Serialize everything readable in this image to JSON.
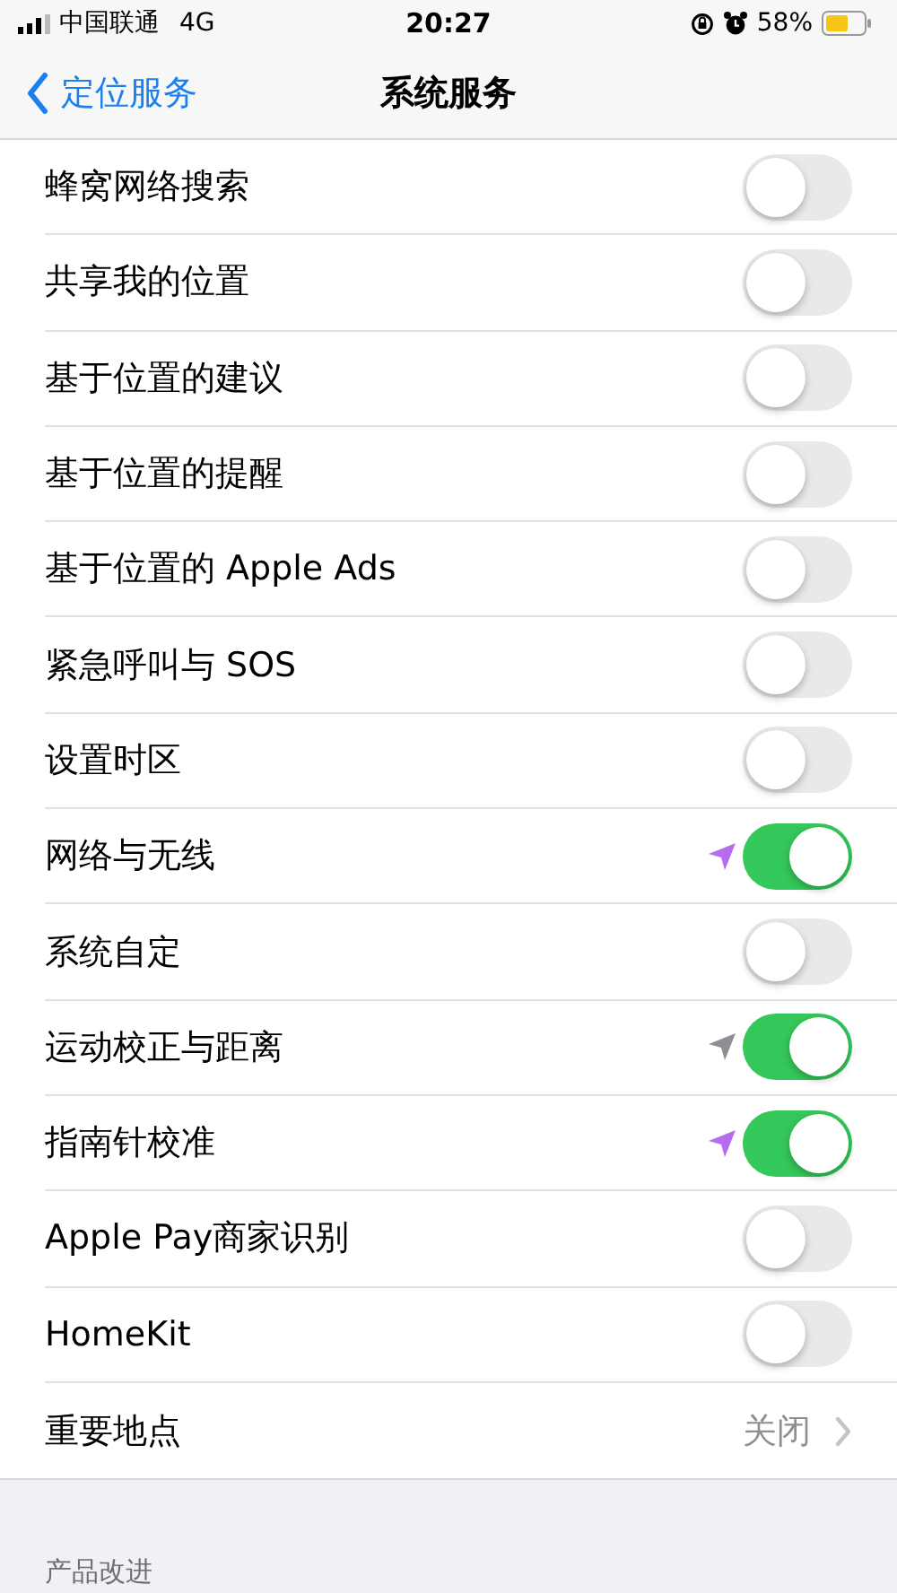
{
  "status_bar": {
    "carrier": "中国联通",
    "network": "4G",
    "time": "20:27",
    "battery": "58%"
  },
  "nav_bar": {
    "back": "定位服务",
    "title": "系统服务"
  },
  "rows": [
    {
      "kind": "toggle",
      "label": "蜂窝网络搜索",
      "on": false
    },
    {
      "kind": "toggle",
      "label": "共享我的位置",
      "on": false
    },
    {
      "kind": "toggle",
      "label": "基于位置的建议",
      "on": false
    },
    {
      "kind": "toggle",
      "label": "基于位置的提醒",
      "on": false
    },
    {
      "kind": "toggle",
      "label": "基于位置的 Apple Ads",
      "on": false
    },
    {
      "kind": "toggle",
      "label": "紧急呼叫与 SOS",
      "on": false
    },
    {
      "kind": "toggle",
      "label": "设置时区",
      "on": false
    },
    {
      "kind": "toggle",
      "label": "网络与无线",
      "on": true,
      "color": "#b46cf0"
    },
    {
      "kind": "toggle",
      "label": "系统自定",
      "on": false
    },
    {
      "kind": "toggle",
      "label": "运动校正与距离",
      "on": true,
      "color": "#8e8e93"
    },
    {
      "kind": "toggle",
      "label": "指南针校准",
      "on": true,
      "color": "#b46cf0"
    },
    {
      "kind": "toggle",
      "label": "Apple Pay商家识别",
      "on": false
    },
    {
      "kind": "toggle",
      "label": "HomeKit",
      "on": false
    },
    {
      "kind": "detail",
      "label": "重要地点",
      "value": "关闭"
    }
  ],
  "section_header": "产品改进"
}
